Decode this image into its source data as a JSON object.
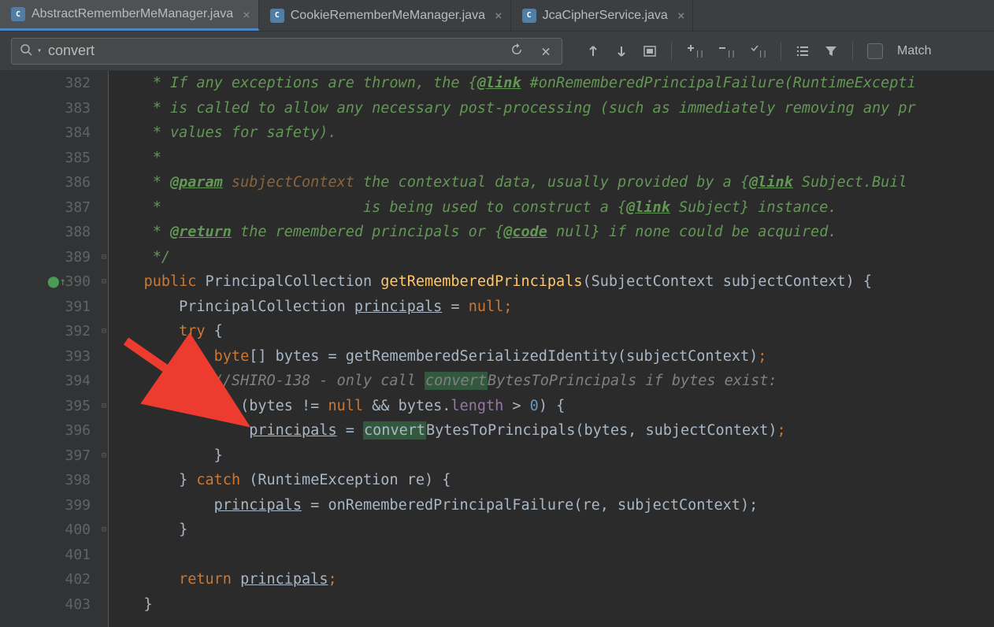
{
  "tabs": [
    {
      "label": "AbstractRememberMeManager.java",
      "active": true
    },
    {
      "label": "CookieRememberMeManager.java",
      "active": false
    },
    {
      "label": "JcaCipherService.java",
      "active": false
    }
  ],
  "search": {
    "value": "convert",
    "match_label": "Match"
  },
  "gutter_lines": [
    "382",
    "383",
    "384",
    "385",
    "386",
    "387",
    "388",
    "389",
    "390",
    "391",
    "392",
    "393",
    "394",
    "395",
    "396",
    "397",
    "398",
    "399",
    "400",
    "401",
    "402",
    "403"
  ],
  "code": {
    "l382": {
      "prefix": "     * If any exceptions are thrown, the {",
      "link": "@link",
      "suffix": " #onRememberedPrincipalFailure(RuntimeExcepti"
    },
    "l383": "     * is called to allow any necessary post-processing (such as immediately removing any pr",
    "l384": "     * values for safety).",
    "l385": "     *",
    "l386": {
      "prefix": "     * ",
      "tag": "@param",
      "param": " subjectContext",
      "rest": " the contextual data, usually provided by a {",
      "link": "@link",
      "tail": " Subject.Buil"
    },
    "l387": {
      "prefix": "     *                       is being used to construct a {",
      "link": "@link",
      "mid": " Subject} instance."
    },
    "l388": {
      "prefix": "     * ",
      "tag": "@return",
      "rest": " the remembered principals or {",
      "code_tag": "@code",
      "tail": " null} if none could be acquired."
    },
    "l389": "     */",
    "l390": {
      "kw_public": "public",
      "type1": " PrincipalCollection ",
      "method": "getRememberedPrincipals",
      "paren_open": "(",
      "param_type": "SubjectContext ",
      "param_name": "subjectContext",
      "close": ") {"
    },
    "l391": {
      "indent": "        ",
      "type": "PrincipalCollection ",
      "var": "principals",
      "assign": " = ",
      "null": "null",
      "semi": ";"
    },
    "l392": {
      "indent": "        ",
      "kw": "try",
      "brace": " {"
    },
    "l393": {
      "indent": "            ",
      "kw": "byte",
      "brackets": "[] ",
      "var": "bytes",
      "assign": " = ",
      "call": "getRememberedSerializedIdentity(subjectContext)",
      "semi": ";"
    },
    "l394": {
      "indent": "            ",
      "comment_prefix": "//SHIRO-138 - only call ",
      "convert": "convert",
      "comment_suffix": "BytesToPrincipals if bytes exist:"
    },
    "l395": {
      "indent": "            ",
      "kw_if": "if",
      "open": " (bytes != ",
      "null": "null",
      "and": " && bytes.",
      "length": "length",
      "cmp": " > ",
      "zero": "0",
      "close": ") {"
    },
    "l396": {
      "indent": "                ",
      "var": "principals",
      "assign": " = ",
      "convert": "convert",
      "call": "BytesToPrincipals(bytes, subjectContext)",
      "semi": ";"
    },
    "l397": "            }",
    "l398": {
      "indent": "        ",
      "brace": "} ",
      "kw": "catch",
      "params": " (RuntimeException re) {"
    },
    "l399": {
      "indent": "            ",
      "var": "principals",
      "assign": " = onRememberedPrincipalFailure(re, subjectContext);"
    },
    "l400": "        }",
    "l401": "",
    "l402": {
      "indent": "        ",
      "kw": "return",
      "sp": " ",
      "var": "principals",
      "semi": ";"
    },
    "l403": "    }"
  }
}
